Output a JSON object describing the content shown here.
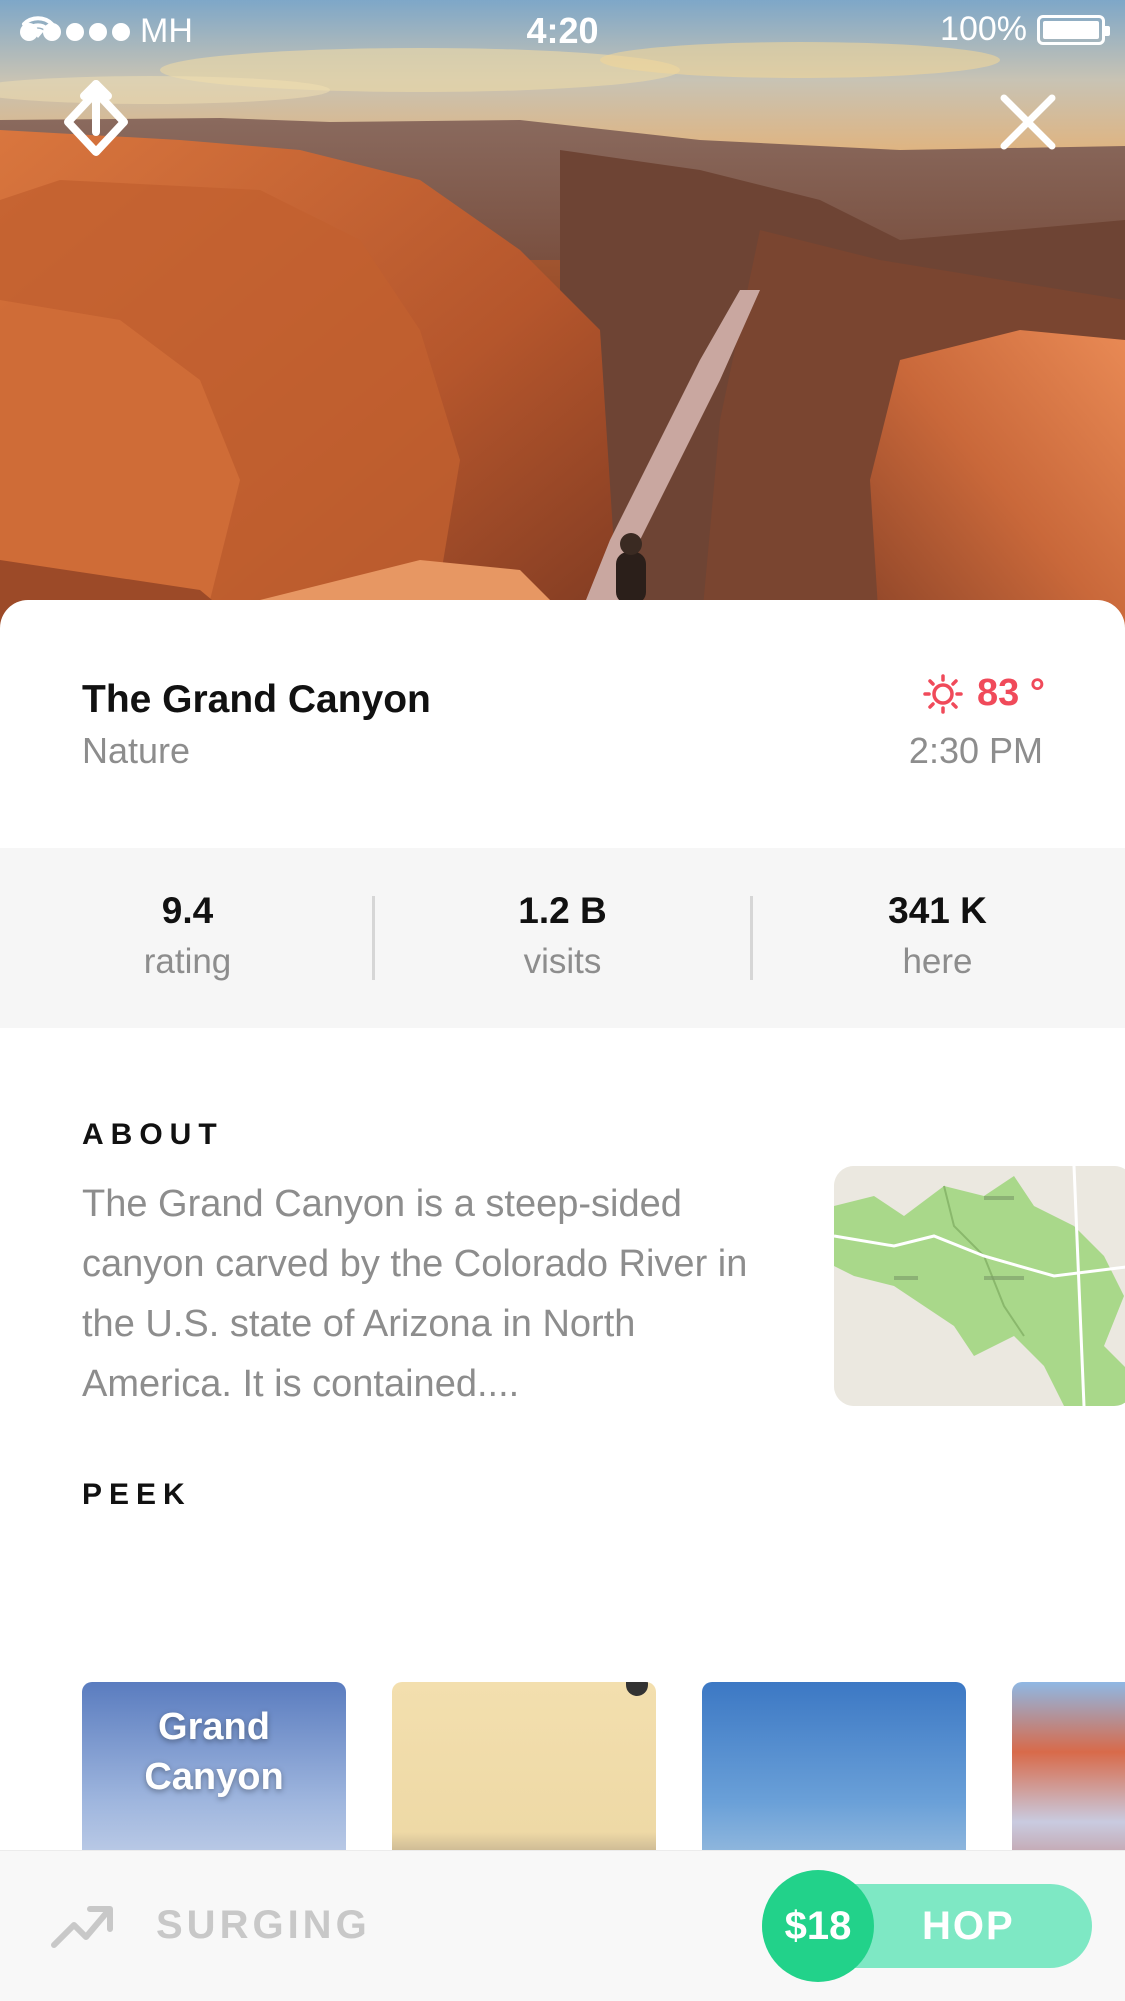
{
  "status_bar": {
    "carrier": "MH",
    "time": "4:20",
    "battery": "100%"
  },
  "hero": {
    "share_icon": "share-diamond-icon",
    "close_icon": "close-icon"
  },
  "place": {
    "title": "The Grand Canyon",
    "category": "Nature",
    "temperature": "83 °",
    "local_time": "2:30 PM",
    "weather_icon": "sun-icon",
    "accent_color": "#f04a5a"
  },
  "stats": [
    {
      "value": "9.4",
      "label": "rating"
    },
    {
      "value": "1.2 B",
      "label": "visits"
    },
    {
      "value": "341 K",
      "label": "here"
    }
  ],
  "about": {
    "heading": "ABOUT",
    "text": "The Grand Canyon is a steep-sided canyon carved by the Colorado River in the U.S. state of Arizona in North America. It is contained...."
  },
  "peek": {
    "heading": "PEEK",
    "cards": [
      {
        "caption_line1": "Grand",
        "caption_line2": "Canyon"
      },
      {
        "caption_line1": "",
        "caption_line2": ""
      },
      {
        "caption_line1": "",
        "caption_line2": ""
      },
      {
        "caption_line1": "",
        "caption_line2": ""
      }
    ]
  },
  "bottom_bar": {
    "trend_icon": "trending-up-icon",
    "status_label": "SURGING",
    "price": "$18",
    "action_label": "HOP",
    "action_color": "#7ee8c4",
    "price_color": "#22d28a"
  }
}
